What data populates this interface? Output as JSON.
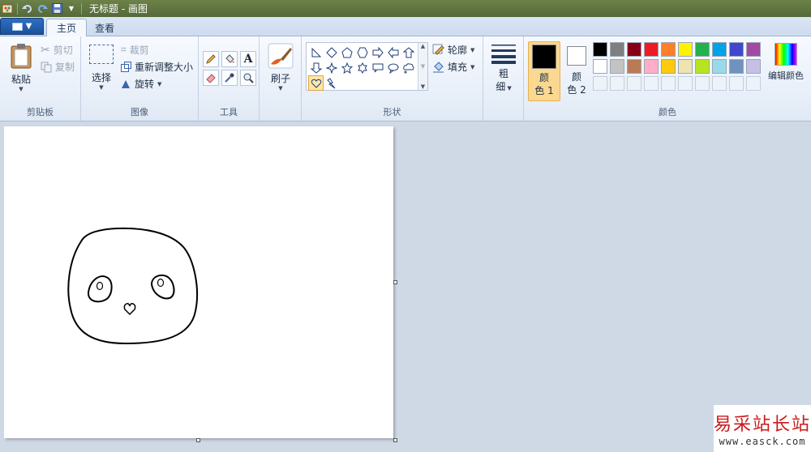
{
  "window": {
    "title": "无标题 - 画图"
  },
  "tabs": [
    {
      "label": "主页",
      "active": true
    },
    {
      "label": "查看",
      "active": false
    }
  ],
  "clipboard": {
    "paste": "粘贴",
    "cut": "剪切",
    "copy": "复制",
    "group_label": "剪贴板"
  },
  "image": {
    "select": "选择",
    "crop": "裁剪",
    "resize": "重新调整大小",
    "rotate": "旋转",
    "group_label": "图像"
  },
  "tools": {
    "group_label": "工具",
    "items": [
      "pencil-icon",
      "fill-icon",
      "text-icon",
      "eraser-icon",
      "color-picker-icon",
      "magnifier-icon"
    ]
  },
  "brushes": {
    "label": "刷子"
  },
  "shapes": {
    "group_label": "形状",
    "outline": "轮廓",
    "fill": "填充"
  },
  "size": {
    "label_top": "粗",
    "label_bottom": "细"
  },
  "colors": {
    "group_label": "颜色",
    "color1_top": "颜",
    "color1_bottom": "色 1",
    "color2_top": "颜",
    "color2_bottom": "色 2",
    "edit": "编辑颜色",
    "color1": "#000000",
    "color2": "#ffffff",
    "palette_row1": [
      "#000000",
      "#7f7f7f",
      "#880015",
      "#ed1c24",
      "#ff7f27",
      "#fff200",
      "#22b14c",
      "#00a2e8",
      "#3f48cc",
      "#a349a4"
    ],
    "palette_row2": [
      "#ffffff",
      "#c3c3c3",
      "#b97a57",
      "#ffaec9",
      "#ffc90e",
      "#efe4b0",
      "#b5e61d",
      "#99d9ea",
      "#7092be",
      "#c8bfe7"
    ]
  },
  "watermark": {
    "title": "易采站长站",
    "url": "www.easck.com"
  }
}
